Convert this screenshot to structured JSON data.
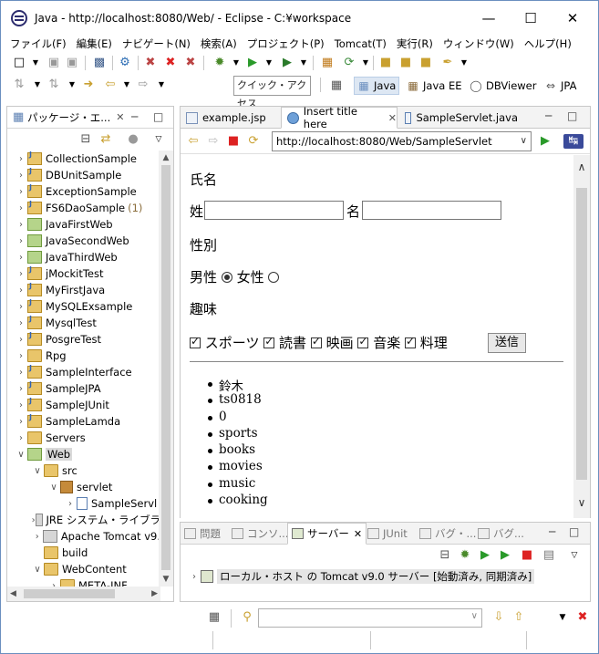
{
  "window": {
    "title": "Java - http://localhost:8080/Web/ - Eclipse - C:¥workspace",
    "controls": {
      "minimize": "—",
      "maximize": "☐",
      "close": "✕"
    }
  },
  "menubar": [
    "ファイル(F)",
    "編集(E)",
    "ナビゲート(N)",
    "検索(A)",
    "プロジェクト(P)",
    "Tomcat(T)",
    "実行(R)",
    "ウィンドウ(W)",
    "ヘルプ(H)"
  ],
  "toolbar": {
    "quick_access": "クイック・アクセス",
    "perspectives": [
      "Java",
      "Java EE",
      "DBViewer",
      "JPA"
    ]
  },
  "package_explorer": {
    "title": "パッケージ・エ...",
    "items": [
      {
        "label": "CollectionSample",
        "type": "proj",
        "arrow": "›"
      },
      {
        "label": "DBUnitSample",
        "type": "proj",
        "arrow": "›"
      },
      {
        "label": "ExceptionSample",
        "type": "proj",
        "arrow": "›"
      },
      {
        "label": "FS6DaoSample",
        "count": "(1)",
        "type": "proj",
        "arrow": "›"
      },
      {
        "label": "JavaFirstWeb",
        "type": "web",
        "arrow": "›"
      },
      {
        "label": "JavaSecondWeb",
        "type": "web",
        "arrow": "›"
      },
      {
        "label": "JavaThirdWeb",
        "type": "web",
        "arrow": "›"
      },
      {
        "label": "jMockitTest",
        "type": "proj",
        "arrow": "›"
      },
      {
        "label": "MyFirstJava",
        "type": "proj",
        "arrow": "›"
      },
      {
        "label": "MySQLExsample",
        "type": "proj",
        "arrow": "›"
      },
      {
        "label": "MysqlTest",
        "type": "proj",
        "arrow": "›"
      },
      {
        "label": "PosgreTest",
        "type": "proj",
        "arrow": "›"
      },
      {
        "label": "Rpg",
        "type": "folder",
        "arrow": "›"
      },
      {
        "label": "SampleInterface",
        "type": "proj",
        "arrow": "›"
      },
      {
        "label": "SampleJPA",
        "type": "proj",
        "arrow": "›"
      },
      {
        "label": "SampleJUnit",
        "type": "proj",
        "arrow": "›"
      },
      {
        "label": "SampleLamda",
        "type": "proj",
        "arrow": "›"
      },
      {
        "label": "Servers",
        "type": "folder",
        "arrow": "›"
      },
      {
        "label": "Web",
        "type": "web",
        "arrow": "∨",
        "selected": true
      },
      {
        "label": "src",
        "type": "folder",
        "arrow": "∨",
        "indent": 1
      },
      {
        "label": "servlet",
        "type": "pkg",
        "arrow": "∨",
        "indent": 2
      },
      {
        "label": "SampleServl",
        "type": "java",
        "arrow": "›",
        "indent": 3
      },
      {
        "label": "JRE システム・ライブラ",
        "type": "lib",
        "arrow": "›",
        "indent": 1
      },
      {
        "label": "Apache Tomcat v9.",
        "type": "lib",
        "arrow": "›",
        "indent": 1
      },
      {
        "label": "build",
        "type": "folder",
        "arrow": "",
        "indent": 1
      },
      {
        "label": "WebContent",
        "type": "folder",
        "arrow": "∨",
        "indent": 1
      },
      {
        "label": "META-INF",
        "type": "folder",
        "arrow": "›",
        "indent": 2
      }
    ]
  },
  "editor": {
    "tabs": [
      "example.jsp",
      "Insert title here",
      "SampleServlet.java"
    ],
    "active_tab": 1,
    "url": "http://localhost:8080/Web/SampleServlet",
    "form": {
      "name_heading": "氏名",
      "last_name_label": "姓",
      "first_name_label": "名",
      "gender_heading": "性別",
      "male_label": "男性",
      "female_label": "女性",
      "hobby_heading": "趣味",
      "hobbies": [
        "スポーツ",
        "読書",
        "映画",
        "音楽",
        "料理"
      ],
      "submit_label": "送信"
    },
    "results": [
      "鈴木",
      "ts0818",
      "0",
      "sports",
      "books",
      "movies",
      "music",
      "cooking"
    ]
  },
  "bottom_panel": {
    "tabs": [
      "問題",
      "コンソ...",
      "サーバー",
      "JUnit",
      "バグ・...",
      "バグ..."
    ],
    "active_tab": 2,
    "server": "ローカル・ホスト の Tomcat v9.0 サーバー  [始動済み, 同期済み]"
  }
}
